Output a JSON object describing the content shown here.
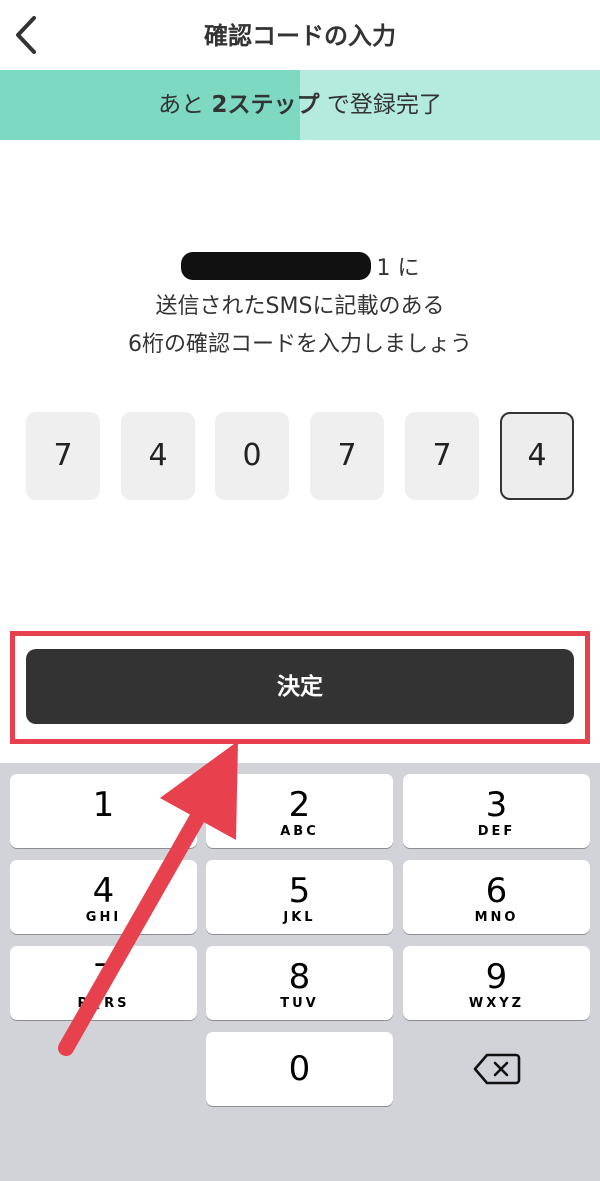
{
  "header": {
    "title": "確認コードの入力",
    "back_icon": "chevron-left-icon"
  },
  "progress": {
    "prefix": "あと",
    "emphasis": "2ステップ",
    "suffix": "で登録完了",
    "filled_fraction": 0.5
  },
  "instructions": {
    "line1_visible_suffix": "1 に",
    "line2": "送信されたSMSに記載のある",
    "line3": "6桁の確認コードを入力しましょう"
  },
  "code": {
    "digits": [
      "7",
      "4",
      "0",
      "7",
      "7",
      "4"
    ],
    "active_index": 5
  },
  "confirm": {
    "label": "決定",
    "highlight_color": "#e6414d"
  },
  "keypad": {
    "keys": [
      {
        "num": "1",
        "letters": ""
      },
      {
        "num": "2",
        "letters": "ABC"
      },
      {
        "num": "3",
        "letters": "DEF"
      },
      {
        "num": "4",
        "letters": "GHI"
      },
      {
        "num": "5",
        "letters": "JKL"
      },
      {
        "num": "6",
        "letters": "MNO"
      },
      {
        "num": "7",
        "letters": "PQRS"
      },
      {
        "num": "8",
        "letters": "TUV"
      },
      {
        "num": "9",
        "letters": "WXYZ"
      },
      {
        "num": "0",
        "letters": ""
      }
    ],
    "delete_icon": "backspace-icon"
  },
  "annotation": {
    "arrow_color": "#e6414d"
  }
}
